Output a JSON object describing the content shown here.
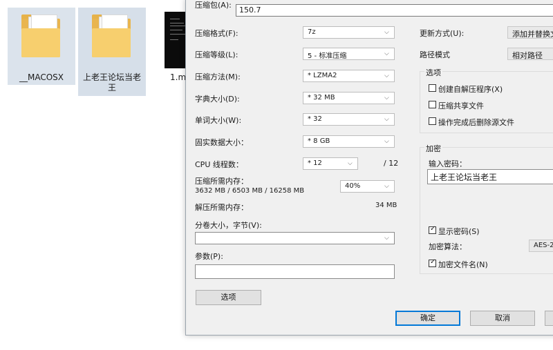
{
  "desktop": {
    "files": [
      {
        "name": "__MACOSX"
      },
      {
        "name": "上老王论坛当老王"
      },
      {
        "name": "1.m"
      }
    ]
  },
  "dialog": {
    "archive_label": "压缩包(A):",
    "archive_value": "150.7",
    "format": {
      "label": "压缩格式(F):",
      "value": "7z"
    },
    "level": {
      "label": "压缩等级(L):",
      "value": "5 - 标准压缩"
    },
    "method": {
      "label": "压缩方法(M):",
      "value": "* LZMA2"
    },
    "dict": {
      "label": "字典大小(D):",
      "value": "* 32 MB"
    },
    "word": {
      "label": "单词大小(W):",
      "value": "* 32"
    },
    "solid": {
      "label": "固实数据大小：",
      "value": "* 8 GB"
    },
    "cpu": {
      "label": "CPU 线程数：",
      "value": "* 12",
      "total": "/ 12"
    },
    "memory": {
      "label": "压缩所需内存：",
      "detail": "3632 MB / 6503 MB / 16258 MB",
      "value": "40%"
    },
    "decompress": {
      "label": "解压所需内存：",
      "value": "34 MB"
    },
    "volume": {
      "label": "分卷大小，字节(V):",
      "value": ""
    },
    "params": {
      "label": "参数(P):",
      "value": ""
    },
    "options_button": "选项",
    "update": {
      "label": "更新方式(U):",
      "value": "添加并替换文"
    },
    "pathmode": {
      "label": "路径模式",
      "value": "相对路径"
    },
    "options_group": {
      "title": "选项",
      "sfx": "创建自解压程序(X)",
      "shared": "压缩共享文件",
      "delete": "操作完成后删除源文件"
    },
    "encryption": {
      "title": "加密",
      "password_label": "输入密码：",
      "password_value": "上老王论坛当老王",
      "show_password": "显示密码(S)",
      "method_label": "加密算法：",
      "method_value": "AES-2",
      "encrypt_names": "加密文件名(N)"
    },
    "ok": "确定",
    "cancel": "取消"
  }
}
